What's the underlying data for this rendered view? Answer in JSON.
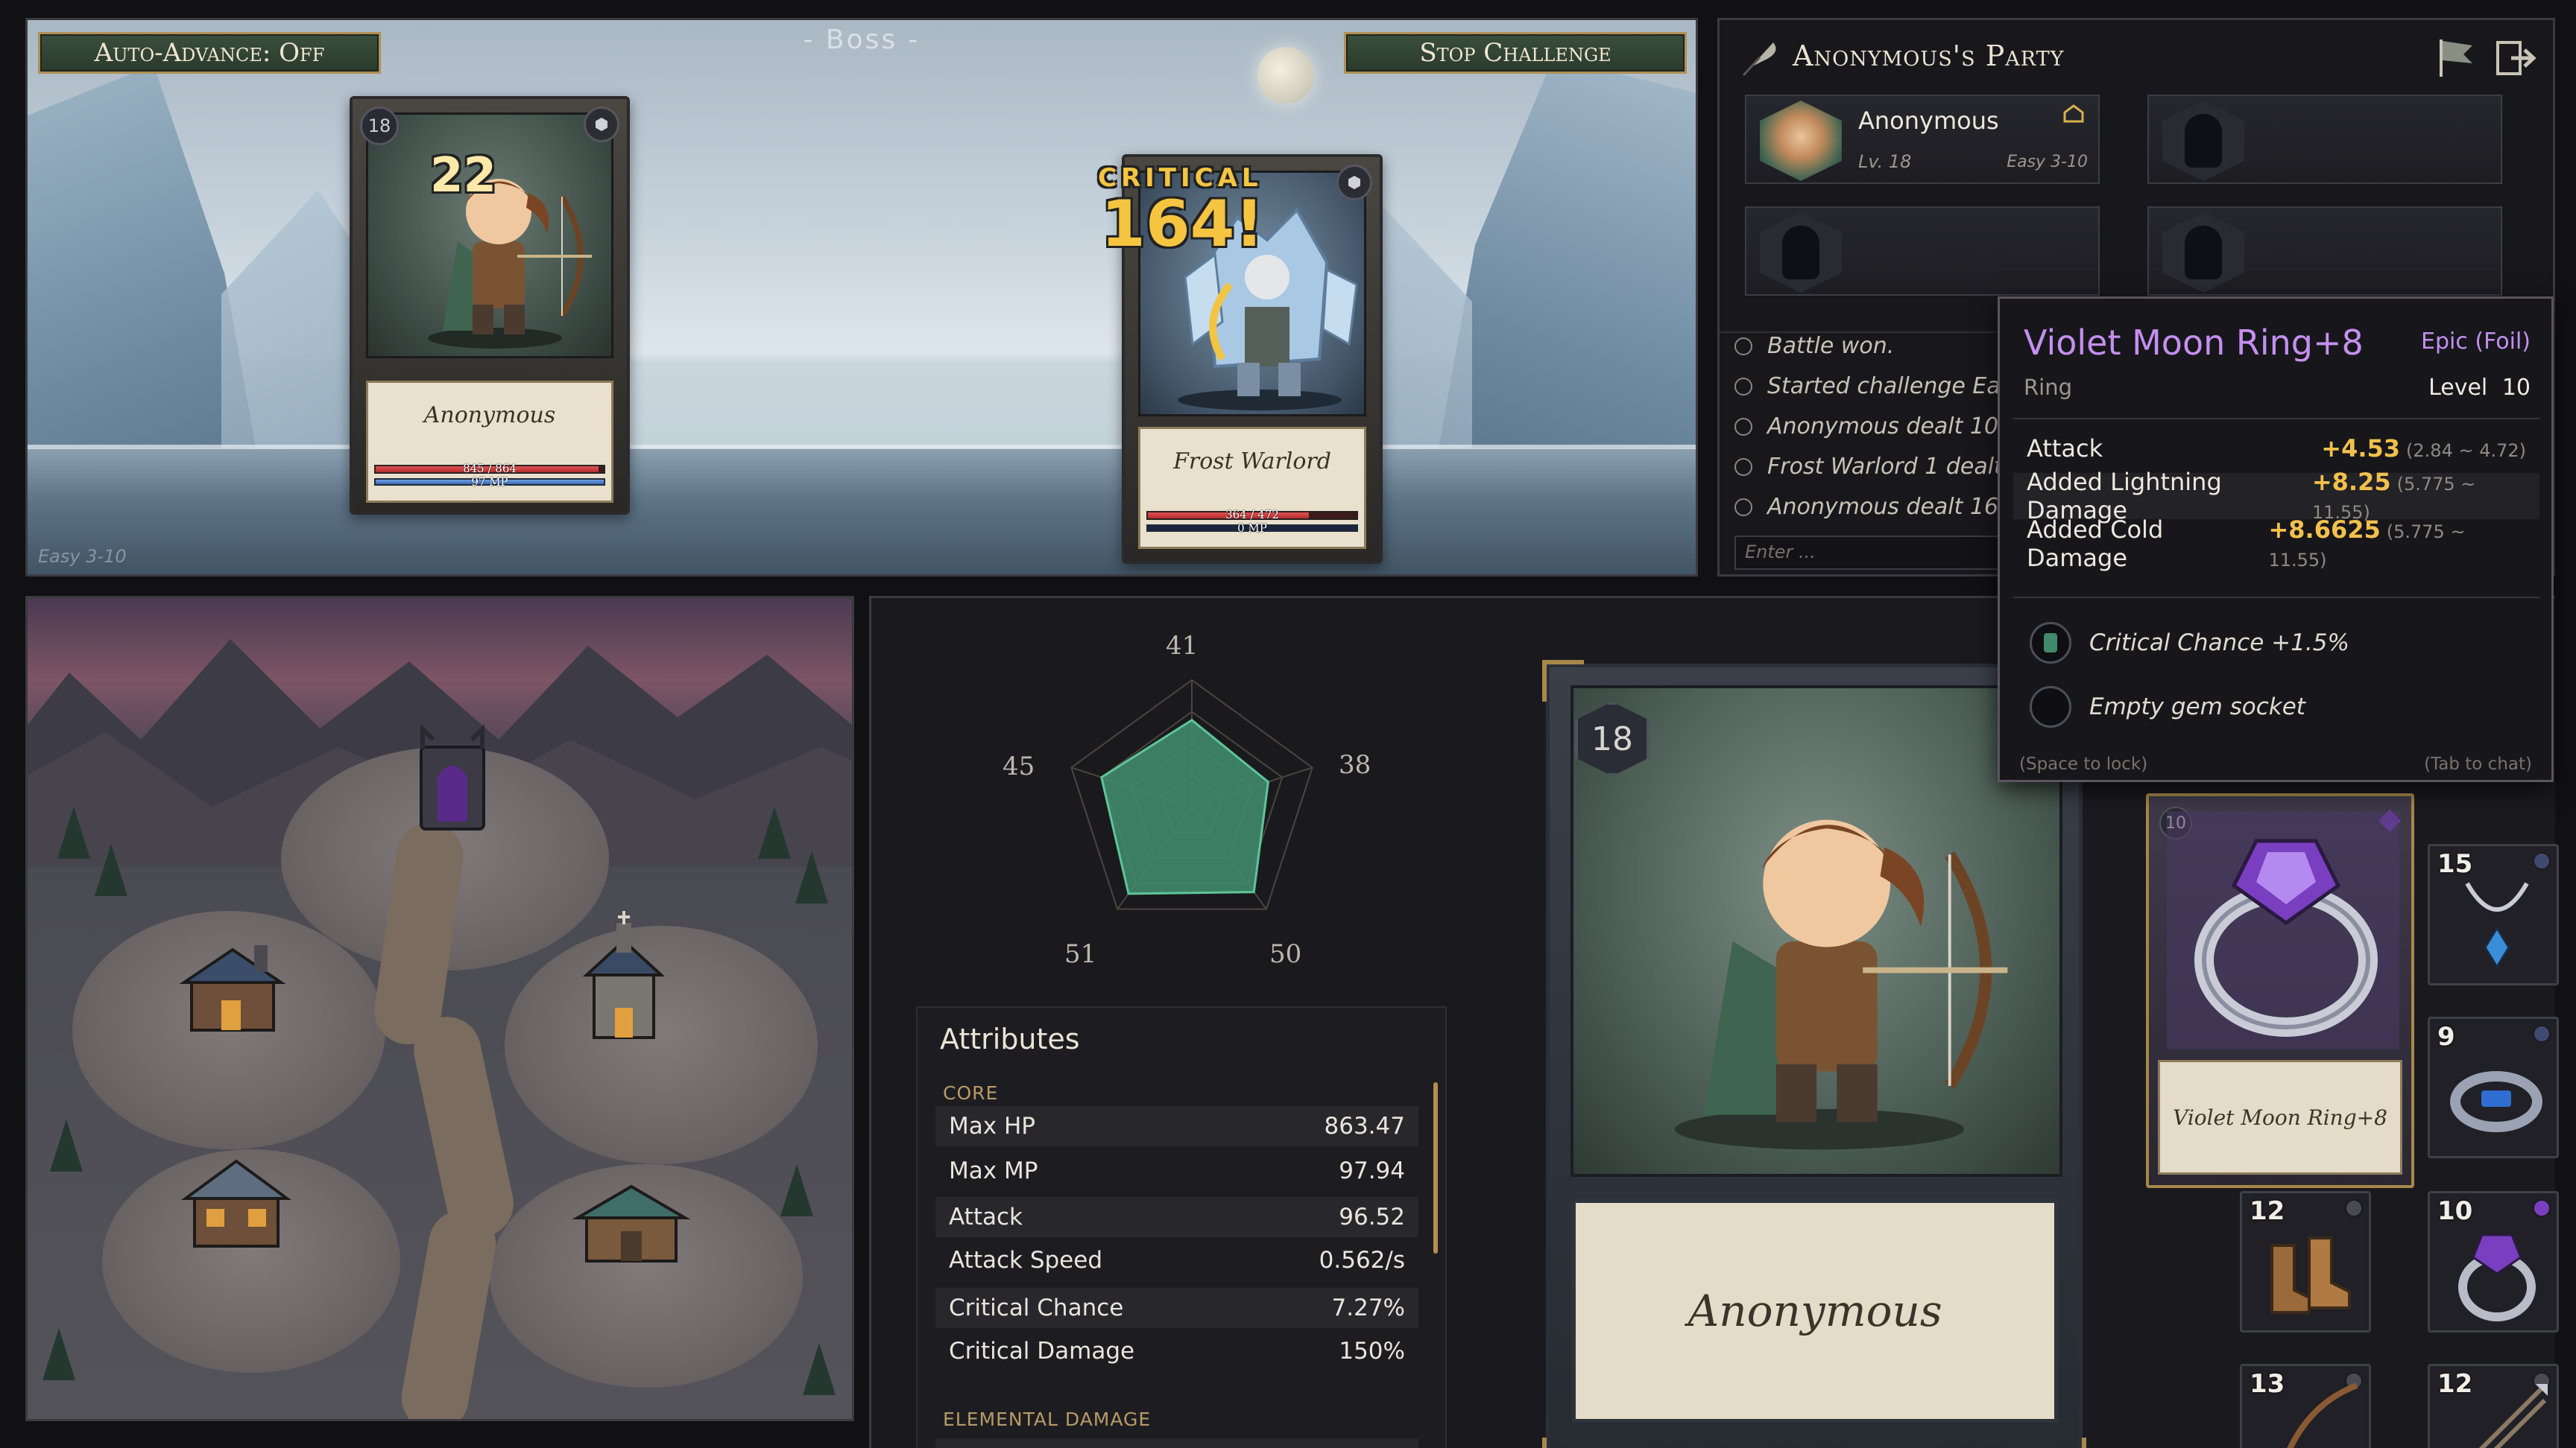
{
  "battle": {
    "auto_advance_label": "Auto-Advance: Off",
    "boss_label": "- Boss -",
    "stop_label": "Stop Challenge",
    "stage_label": "Easy 3-10",
    "player": {
      "level": "18",
      "name": "Anonymous",
      "hp_text": "845 / 864",
      "mp_text": "97 MP",
      "hp_fraction": 0.978,
      "mp_fraction": 1.0,
      "damage_taken": "22"
    },
    "enemy": {
      "name": "Frost Warlord",
      "hp_text": "364 / 472",
      "mp_text": "0 MP",
      "hp_fraction": 0.771,
      "mp_fraction": 0.0,
      "critical_label": "CRITICAL",
      "damage_taken": "164!"
    }
  },
  "party": {
    "title": "Anonymous's Party",
    "icons": [
      "quill-icon",
      "flag-icon",
      "exit-icon"
    ],
    "member": {
      "name": "Anonymous",
      "level": "Lv. 18",
      "stage": "Easy 3-10"
    },
    "log": [
      "Battle won.",
      "Started challenge Eas",
      "Anonymous dealt 10",
      "Frost Warlord 1 dealt",
      "Anonymous dealt 164"
    ],
    "chat_placeholder": "Enter ..."
  },
  "radar": {
    "labels": [
      "41",
      "38",
      "50",
      "51",
      "45"
    ],
    "values": [
      41,
      38,
      50,
      51,
      45
    ]
  },
  "attributes": {
    "title": "Attributes",
    "core_label": "CORE",
    "elemental_label": "ELEMENTAL DAMAGE",
    "rows": [
      {
        "name": "Max HP",
        "value": "863.47"
      },
      {
        "name": "Max MP",
        "value": "97.94"
      },
      {
        "name": "Attack",
        "value": "96.52"
      },
      {
        "name": "Attack Speed",
        "value": "0.562/s"
      },
      {
        "name": "Critical Chance",
        "value": "7.27%"
      },
      {
        "name": "Critical Damage",
        "value": "150%"
      }
    ]
  },
  "character_card": {
    "level": "18",
    "name": "Anonymous"
  },
  "equipment": {
    "ring_card": {
      "level": "10",
      "name": "Violet Moon Ring+8"
    },
    "slots": [
      {
        "level": "15",
        "item": "necklace"
      },
      {
        "level": "9",
        "item": "bracelet"
      },
      {
        "level": "12",
        "item": "boots"
      },
      {
        "level": "10",
        "item": "ring"
      },
      {
        "level": "13",
        "item": "bow"
      },
      {
        "level": "12",
        "item": "arrows"
      }
    ]
  },
  "tooltip": {
    "name": "Violet Moon Ring+8",
    "rarity": "Epic (Foil)",
    "type": "Ring",
    "level_label": "Level",
    "level_value": "10",
    "stats": [
      {
        "name": "Attack",
        "value": "+4.53",
        "range": "(2.84 ~ 4.72)"
      },
      {
        "name": "Added Lightning Damage",
        "value": "+8.25",
        "range": "(5.775 ~ 11.55)"
      },
      {
        "name": "Added Cold Damage",
        "value": "+8.6625",
        "range": "(5.775 ~ 11.55)"
      }
    ],
    "gem_mod": "Critical Chance +1.5%",
    "empty_socket": "Empty gem socket",
    "hint_lock": "(Space to lock)",
    "hint_chat": "(Tab to chat)"
  },
  "colors": {
    "accent_gold": "#b09055",
    "epic_purple": "#c58ff0",
    "stat_value": "#f2c04c",
    "radar_fill": "#3f8a6a"
  }
}
